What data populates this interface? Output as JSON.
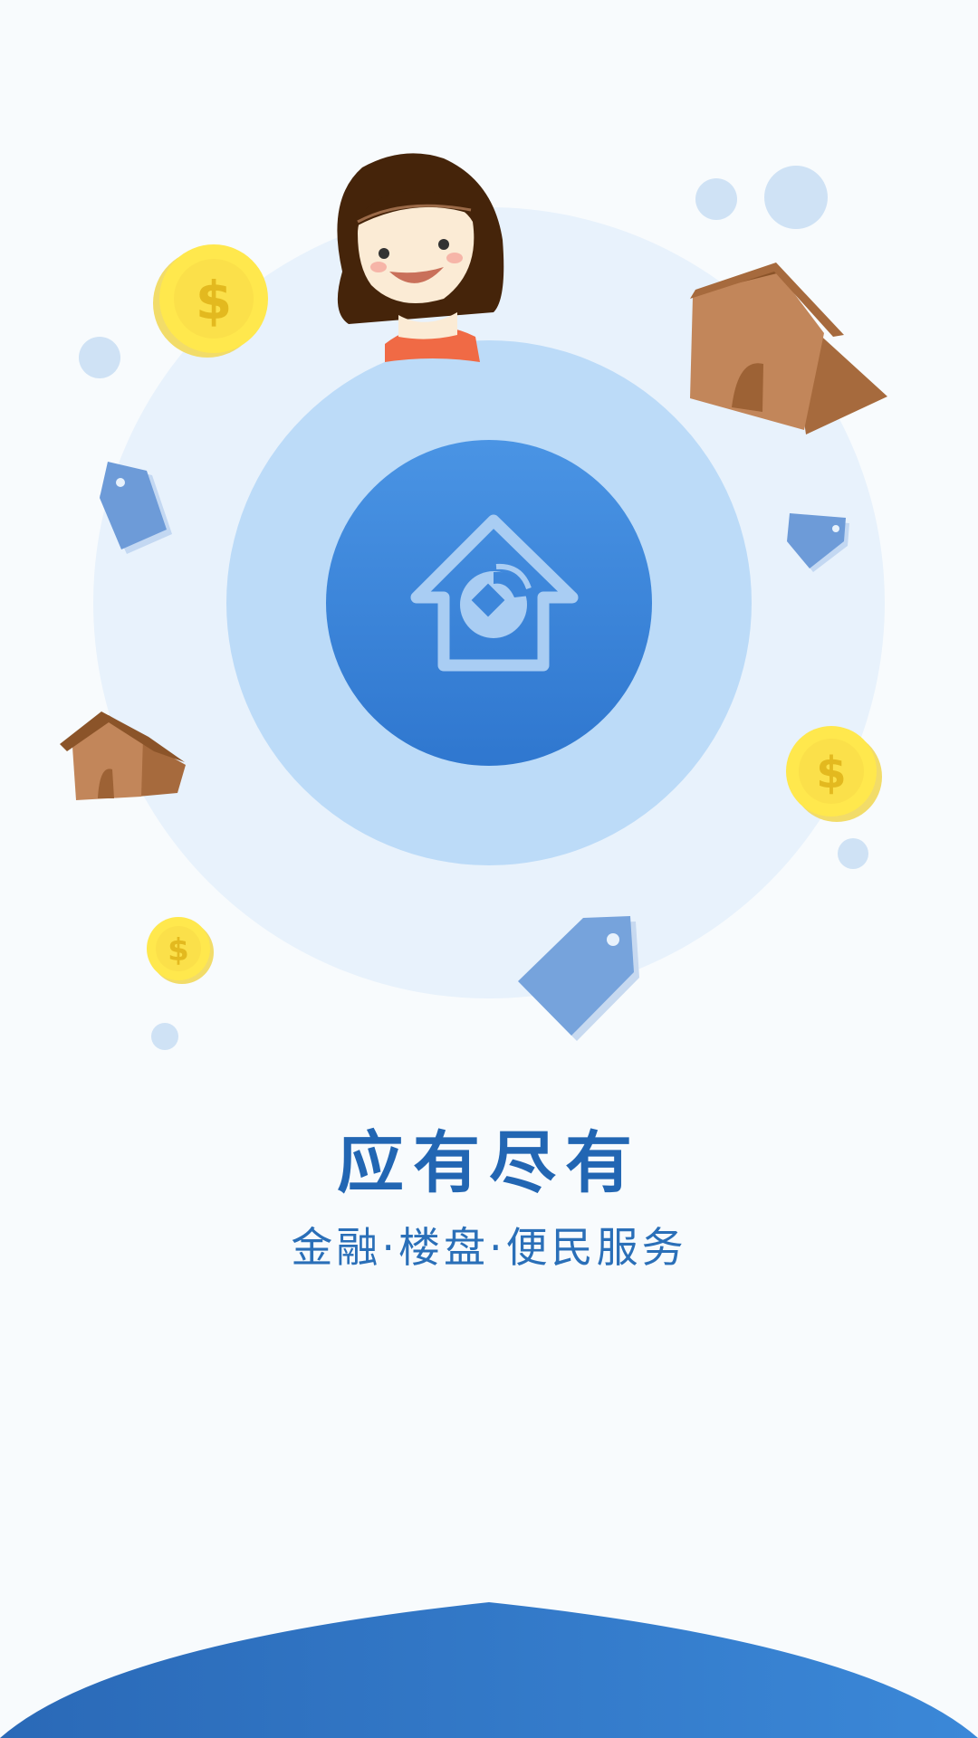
{
  "splash": {
    "title": "应有尽有",
    "subtitle": "金融·楼盘·便民服务"
  },
  "icons": {
    "center": "home-bank-logo-icon",
    "decor": [
      "coin-icon",
      "house-icon",
      "price-tag-icon",
      "girl-avatar"
    ]
  },
  "colors": {
    "accent": "#2e74c8",
    "title": "#2266b3",
    "circle_outer": "#e7f1fb",
    "circle_mid": "#bcdaf8",
    "circle_inner": "#3d86da"
  }
}
